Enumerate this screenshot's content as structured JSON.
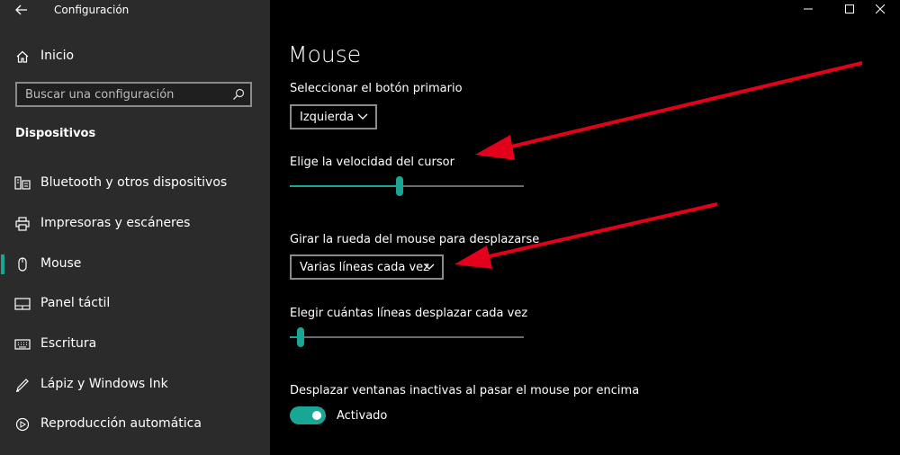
{
  "window": {
    "title": "Configuración",
    "controls": [
      "minimize-icon",
      "maximize-icon",
      "close-icon"
    ]
  },
  "sidebar": {
    "home_label": "Inicio",
    "search": {
      "placeholder": "Buscar una configuración",
      "value": ""
    },
    "section_title": "Dispositivos",
    "items": [
      {
        "label": "Bluetooth y otros dispositivos",
        "icon": "bluetooth-devices-icon",
        "selected": false
      },
      {
        "label": "Impresoras y escáneres",
        "icon": "printer-icon",
        "selected": false
      },
      {
        "label": "Mouse",
        "icon": "mouse-icon",
        "selected": true
      },
      {
        "label": "Panel táctil",
        "icon": "touchpad-icon",
        "selected": false
      },
      {
        "label": "Escritura",
        "icon": "keyboard-icon",
        "selected": false
      },
      {
        "label": "Lápiz y Windows Ink",
        "icon": "pen-icon",
        "selected": false
      },
      {
        "label": "Reproducción automática",
        "icon": "autoplay-icon",
        "selected": false
      }
    ]
  },
  "main": {
    "title": "Mouse",
    "primary_button": {
      "label": "Seleccionar el botón primario",
      "value": "Izquierda"
    },
    "cursor_speed": {
      "label": "Elige la velocidad del cursor",
      "value_fraction": 0.47
    },
    "scroll_wheel": {
      "label": "Girar la rueda del mouse para desplazarse",
      "value": "Varias líneas cada vez"
    },
    "lines_to_scroll": {
      "label": "Elegir cuántas líneas desplazar cada vez",
      "value_fraction": 0.03
    },
    "inactive_scroll": {
      "label": "Desplazar ventanas inactivas al pasar el mouse por encima",
      "state": "Activado"
    }
  },
  "colors": {
    "accent": "#19a795",
    "sidebar_bg": "#2b2b2b",
    "main_bg": "#000000",
    "annotation_arrow": "#e3001b"
  }
}
